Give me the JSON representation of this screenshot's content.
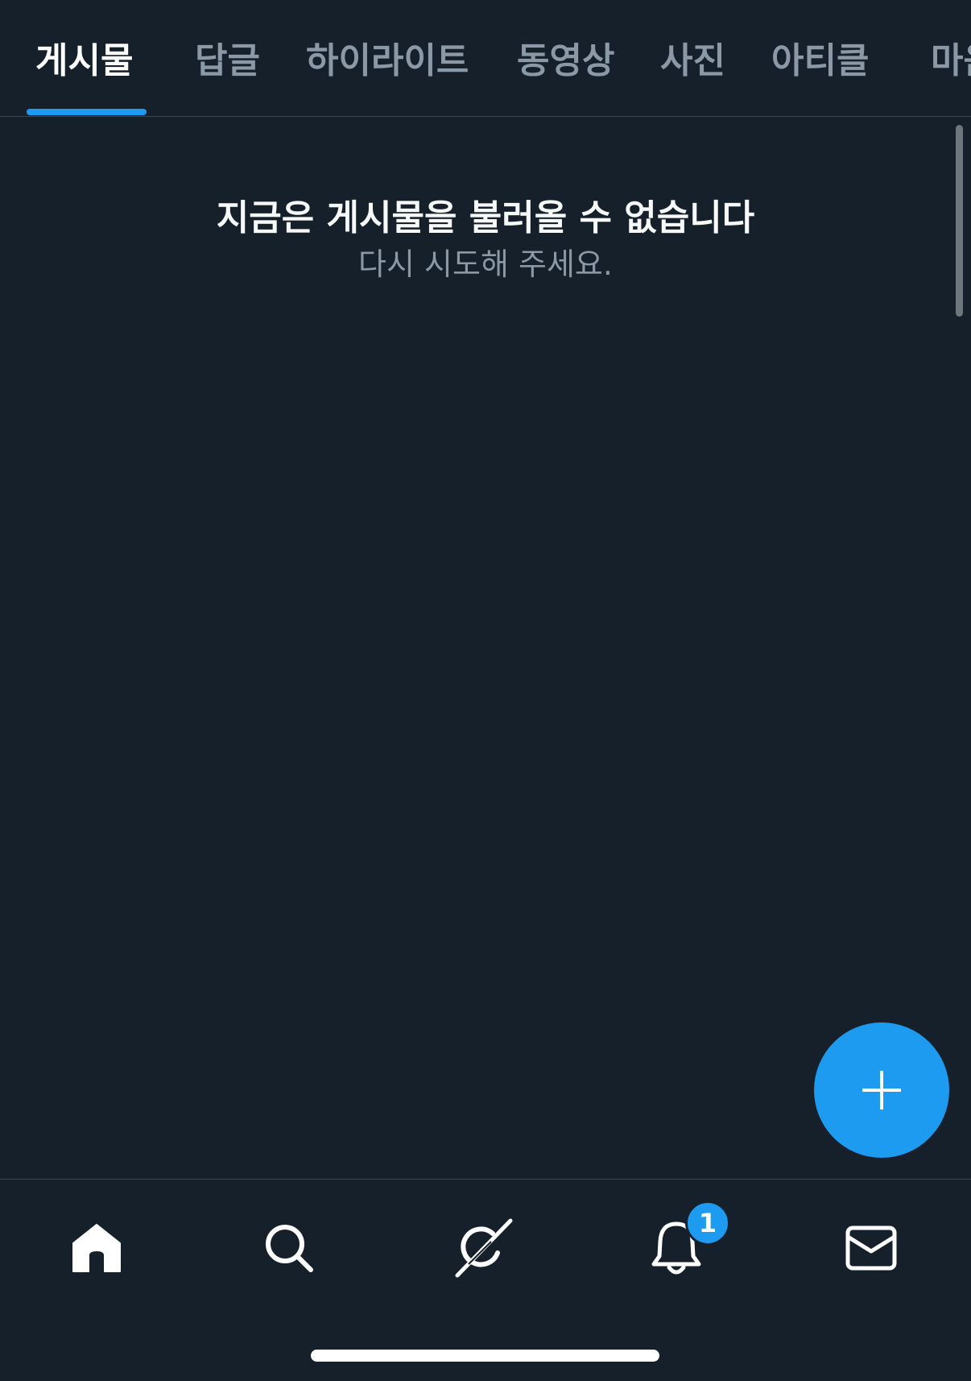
{
  "tabs": [
    {
      "label": "게시물",
      "active": true
    },
    {
      "label": "답글",
      "active": false
    },
    {
      "label": "하이라이트",
      "active": false
    },
    {
      "label": "동영상",
      "active": false
    },
    {
      "label": "사진",
      "active": false
    },
    {
      "label": "아티클",
      "active": false
    },
    {
      "label": "마음",
      "active": false
    }
  ],
  "empty_state": {
    "title": "지금은 게시물을 불러올 수 없습니다",
    "subtitle": "다시 시도해 주세요."
  },
  "fab": {
    "icon": "plus-icon"
  },
  "bottom_nav": {
    "items": [
      {
        "name": "home",
        "icon": "home-icon",
        "active": true
      },
      {
        "name": "search",
        "icon": "search-icon",
        "active": false
      },
      {
        "name": "grok",
        "icon": "grok-icon",
        "active": false
      },
      {
        "name": "notifications",
        "icon": "bell-icon",
        "active": false
      },
      {
        "name": "messages",
        "icon": "mail-icon",
        "active": false
      }
    ],
    "notification_badge": "1"
  },
  "colors": {
    "background": "#15202b",
    "accent": "#1d9bf0",
    "muted_text": "#8b98a5",
    "divider": "#38444d"
  }
}
